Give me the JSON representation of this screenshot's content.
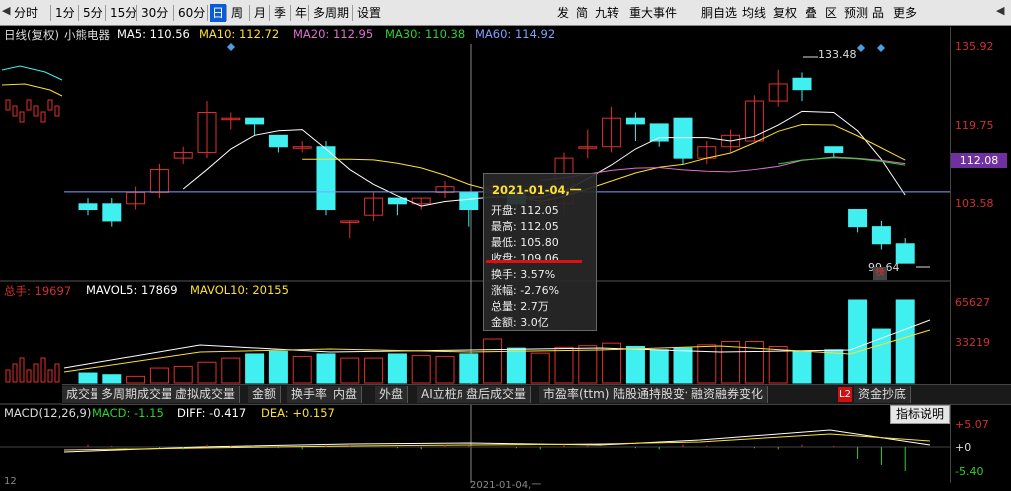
{
  "toolbar": {
    "left": [
      "分时",
      "1分",
      "5分",
      "15分",
      "30分",
      "60分",
      "日",
      "周",
      "月",
      "季",
      "年",
      "多周期",
      "设置"
    ],
    "right": [
      "发",
      "简",
      "九转",
      "重大事件",
      "胴自选",
      "均线",
      "复权",
      "叠",
      "区",
      "预测",
      "品",
      "更多"
    ]
  },
  "ma": {
    "title": "日线(复权)",
    "stock": "小熊电器",
    "ma5": "MA5: 110.56",
    "ma10": "MA10: 112.72",
    "ma20": "MA20: 112.95",
    "ma30": "MA30: 110.38",
    "ma60": "MA60: 114.92"
  },
  "price_axis": [
    "135.92",
    "119.75",
    "112.08",
    "103.58"
  ],
  "high_label": "133.48",
  "low_label": "99.64",
  "badge": "榜",
  "tooltip": {
    "date": "2021-01-04,一",
    "rows": [
      "开盘: 112.05",
      "最高: 112.05",
      "最低: 105.80",
      "收盘: 109.06",
      "换手: 3.57%",
      "涨幅: -2.76%",
      "总量: 2.7万",
      "金额: 3.0亿"
    ]
  },
  "vol": {
    "total": "总手: 19697",
    "mavol5": "MAVOL5: 17869",
    "mavol10": "MAVOL10: 20155",
    "axis": [
      "65627",
      "33219"
    ]
  },
  "tabs": [
    "成交量",
    "多周期成交量",
    "虚拟成交量",
    "金额",
    "换手率",
    "内盘",
    "外盘",
    "AI立桩成交量",
    "盘后成交量",
    "市盈率(ttm)",
    "陆股通持股变化",
    "融资融券变化",
    "资金抄底"
  ],
  "tab_l2": "L2",
  "indicator_btn": "指标说明",
  "macd": {
    "title": "MACD(12,26,9)",
    "macd": "MACD: -1.15",
    "diff": "DIFF: -0.417",
    "dea": "DEA: +0.157",
    "axis": [
      "+5.07",
      "+0",
      "-5.40"
    ]
  },
  "bottom_date": "2021-01-04,一",
  "bottom_left": "12",
  "chart_data": {
    "type": "candlestick",
    "candles": [
      {
        "o": 110,
        "c": 109,
        "h": 111,
        "l": 108
      },
      {
        "o": 110,
        "c": 107,
        "h": 111,
        "l": 106
      },
      {
        "o": 110,
        "c": 112,
        "h": 113,
        "l": 109
      },
      {
        "o": 112,
        "c": 116,
        "h": 117,
        "l": 111
      },
      {
        "o": 118,
        "c": 119,
        "h": 120,
        "l": 117
      },
      {
        "o": 119,
        "c": 126,
        "h": 128,
        "l": 118
      },
      {
        "o": 125,
        "c": 125,
        "h": 126,
        "l": 123
      },
      {
        "o": 125,
        "c": 124,
        "h": 125,
        "l": 122
      },
      {
        "o": 122,
        "c": 120,
        "h": 122,
        "l": 119
      },
      {
        "o": 120,
        "c": 120,
        "h": 121,
        "l": 119
      },
      {
        "o": 120,
        "c": 109,
        "h": 121,
        "l": 108
      },
      {
        "o": 107,
        "c": 107,
        "h": 107,
        "l": 104
      },
      {
        "o": 108,
        "c": 111,
        "h": 112,
        "l": 107
      },
      {
        "o": 111,
        "c": 110,
        "h": 111,
        "l": 108
      },
      {
        "o": 110,
        "c": 111,
        "h": 111,
        "l": 109
      },
      {
        "o": 112,
        "c": 113,
        "h": 114,
        "l": 111
      },
      {
        "o": 112,
        "c": 109,
        "h": 112,
        "l": 106
      },
      {
        "o": 112,
        "c": 113,
        "h": 114,
        "l": 111
      },
      {
        "o": 112,
        "c": 110,
        "h": 113,
        "l": 109
      },
      {
        "o": 110,
        "c": 111,
        "h": 112,
        "l": 109
      },
      {
        "o": 110,
        "c": 118,
        "h": 119,
        "l": 108
      },
      {
        "o": 120,
        "c": 120,
        "h": 123,
        "l": 118
      },
      {
        "o": 120,
        "c": 125,
        "h": 127,
        "l": 119
      },
      {
        "o": 125,
        "c": 124,
        "h": 126,
        "l": 121
      },
      {
        "o": 124,
        "c": 121,
        "h": 124,
        "l": 120
      },
      {
        "o": 125,
        "c": 118,
        "h": 125,
        "l": 117
      },
      {
        "o": 118,
        "c": 120,
        "h": 121,
        "l": 117
      },
      {
        "o": 120,
        "c": 122,
        "h": 123,
        "l": 119
      },
      {
        "o": 121,
        "c": 128,
        "h": 129,
        "l": 121
      },
      {
        "o": 128,
        "c": 131,
        "h": 133.5,
        "l": 127
      },
      {
        "o": 132,
        "c": 130,
        "h": 133,
        "l": 128
      },
      {
        "o": 120,
        "c": 119,
        "h": 120,
        "l": 118
      },
      {
        "o": 109,
        "c": 106,
        "h": 109,
        "l": 105
      },
      {
        "o": 106,
        "c": 103,
        "h": 107,
        "l": 102
      },
      {
        "o": 103,
        "c": 99.6,
        "h": 104,
        "l": 99.6
      }
    ]
  }
}
